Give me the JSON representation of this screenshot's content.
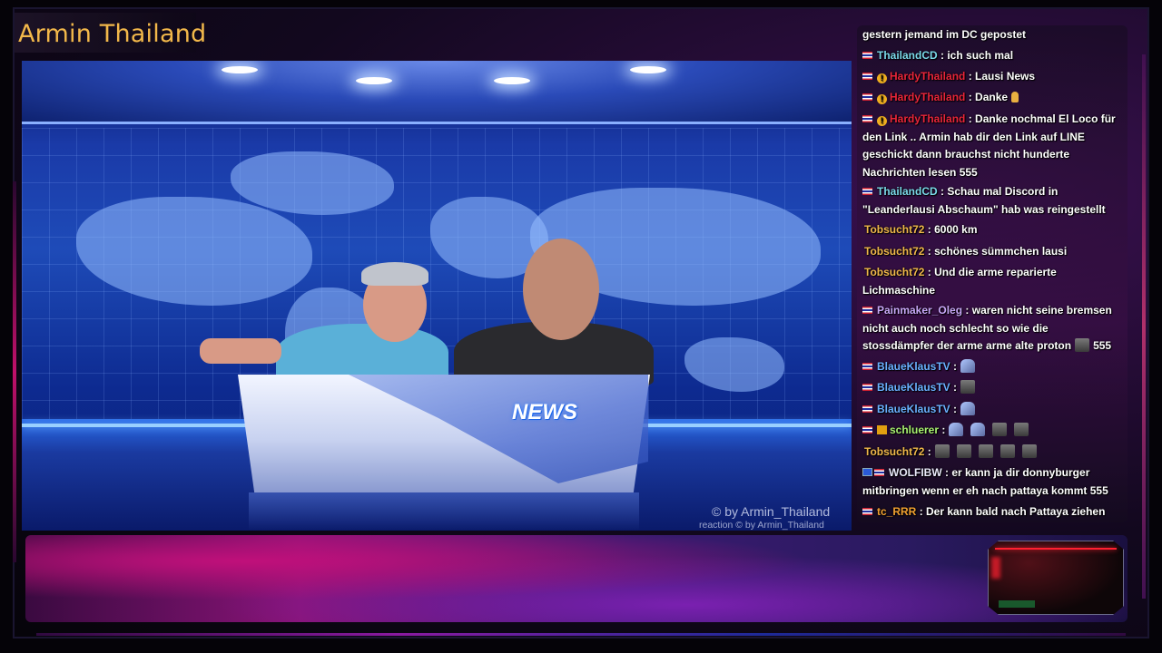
{
  "stream": {
    "title": "Armin Thailand",
    "desk_label": "NEWS",
    "watermark_main": "© by Armin_Thailand",
    "watermark_sub": "reaction  © by Armin_Thailand"
  },
  "colors": {
    "title": "#f2b84a",
    "user_thailandcd": "#7ad8e8",
    "user_hardy": "#e8253a",
    "user_tobsucht": "#f0b84a",
    "user_painmaker": "#c8a8f8",
    "user_blaueklaus": "#6ab0ff",
    "user_schluerer": "#a8f070",
    "user_wolfibw": "#e8e8f8",
    "user_tcrrr": "#f0a030"
  },
  "chat": {
    "messages": [
      {
        "user": "",
        "text": "gestern jemand im DC gepostet"
      },
      {
        "user": "ThailandCD",
        "text": ": ich such mal"
      },
      {
        "user": "HardyThailand",
        "text": ": Lausi News"
      },
      {
        "user": "HardyThailand",
        "text": ": Danke"
      },
      {
        "user": "HardyThailand",
        "text": ": Danke nochmal El Loco für den Link .. Armin hab dir den Link auf LINE geschickt dann brauchst nicht hunderte Nachrichten lesen 555"
      },
      {
        "user": "ThailandCD",
        "text": ": Schau mal Discord in \"Leanderlausi Abschaum\" hab was reingestellt"
      },
      {
        "user": "Tobsucht72",
        "text": ": 6000 km"
      },
      {
        "user": "Tobsucht72",
        "text": ": schönes sümmchen lausi"
      },
      {
        "user": "Tobsucht72",
        "text": ": Und die arme reparierte Lichmaschine"
      },
      {
        "user": "Painmaker_Oleg",
        "text": ": waren nicht seine bremsen nicht auch noch schlecht so wie die stossdämpfer der arme arme alte proton",
        "suffix": "555"
      },
      {
        "user": "BlaueKlausTV",
        "text": ":"
      },
      {
        "user": "BlaueKlausTV",
        "text": ":"
      },
      {
        "user": "BlaueKlausTV",
        "text": ":"
      },
      {
        "user": "schluerer",
        "text": ":"
      },
      {
        "user": "Tobsucht72",
        "text": ":"
      },
      {
        "user": "WOLFIBW",
        "text": ": er kann ja dir donnyburger mitbringen wenn er eh nach pattaya kommt 555"
      },
      {
        "user": "tc_RRR",
        "text": ": Der kann bald nach Pattaya ziehen"
      }
    ]
  },
  "icons": [
    "thai-flag-icon",
    "eu-flag-icon",
    "subscriber-badge-icon",
    "emote-icon",
    "pray-hands-icon",
    "ceiling-light-icon"
  ]
}
